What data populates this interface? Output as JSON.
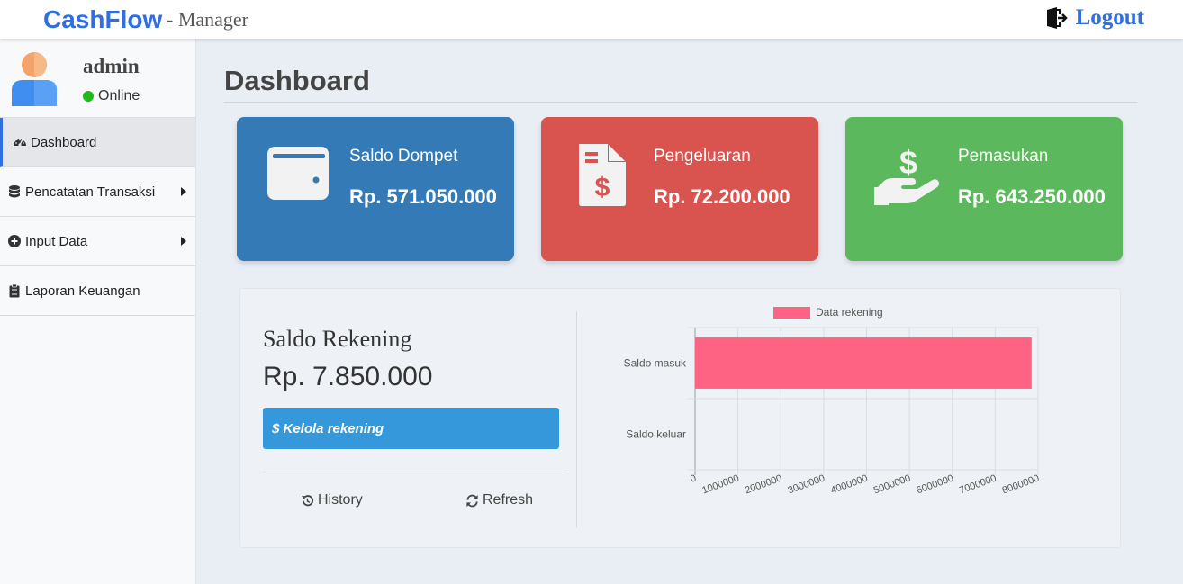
{
  "app": {
    "brand": "CashFlow",
    "brand_suffix": "- Manager",
    "logout_label": "Logout"
  },
  "user": {
    "name": "admin",
    "status": "Online",
    "status_color": "#1db91d"
  },
  "sidebar": {
    "items": [
      {
        "label": "Dashboard",
        "icon": "tachometer-icon",
        "active": true
      },
      {
        "label": "Pencatatan Transaksi",
        "icon": "database-icon",
        "has_submenu": true
      },
      {
        "label": "Input Data",
        "icon": "plus-circle-icon",
        "has_submenu": true
      },
      {
        "label": "Laporan Keuangan",
        "icon": "clipboard-icon"
      }
    ]
  },
  "page": {
    "title": "Dashboard"
  },
  "cards": [
    {
      "label": "Saldo Dompet",
      "value": "Rp. 571.050.000",
      "icon": "wallet-icon",
      "color": "#337ab7"
    },
    {
      "label": "Pengeluaran",
      "value": "Rp. 72.200.000",
      "icon": "file-invoice-dollar-icon",
      "color": "#d9534f"
    },
    {
      "label": "Pemasukan",
      "value": "Rp. 643.250.000",
      "icon": "hand-holding-dollar-icon",
      "color": "#5cb85c"
    }
  ],
  "account_panel": {
    "title": "Saldo Rekening",
    "amount": "Rp. 7.850.000",
    "manage_button": "$ Kelola rekening",
    "history_label": "History",
    "refresh_label": "Refresh"
  },
  "chart_data": {
    "type": "bar",
    "orientation": "horizontal",
    "categories": [
      "Saldo masuk",
      "Saldo keluar"
    ],
    "series": [
      {
        "name": "Data rekening",
        "values": [
          7850000,
          0
        ],
        "color": "#ff6384"
      }
    ],
    "xlim": [
      0,
      8000000
    ],
    "x_ticks": [
      0,
      1000000,
      2000000,
      3000000,
      4000000,
      5000000,
      6000000,
      7000000,
      8000000
    ],
    "legend_position": "top",
    "grid": true
  }
}
